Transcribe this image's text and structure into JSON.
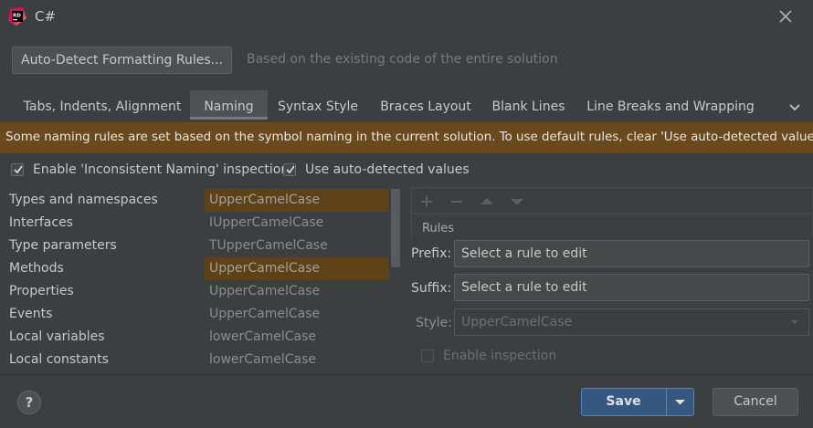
{
  "window": {
    "title": "C#",
    "logo": "rider-logo-icon",
    "close_icon": "close-icon"
  },
  "autodetect": {
    "button_label": "Auto-Detect Formatting Rules...",
    "description": "Based on the existing code of the entire solution"
  },
  "tabs": [
    {
      "label": "Tabs, Indents, Alignment",
      "active": false
    },
    {
      "label": "Naming",
      "active": true
    },
    {
      "label": "Syntax Style",
      "active": false
    },
    {
      "label": "Braces Layout",
      "active": false
    },
    {
      "label": "Blank Lines",
      "active": false
    },
    {
      "label": "Line Breaks and Wrapping",
      "active": false
    }
  ],
  "banner": {
    "text": "Some naming rules are set based on the symbol naming in the current solution. To use default rules, clear 'Use auto-detected values'.",
    "color": "#6a4a1c"
  },
  "options": {
    "inconsistent_naming": {
      "label": "Enable 'Inconsistent Naming' inspection",
      "checked": true
    },
    "auto_detected": {
      "label": "Use auto-detected values",
      "checked": true
    }
  },
  "rules": [
    {
      "name": "Types and namespaces",
      "value": "UpperCamelCase",
      "highlighted": true
    },
    {
      "name": "Interfaces",
      "value": "IUpperCamelCase",
      "highlighted": false
    },
    {
      "name": "Type parameters",
      "value": "TUpperCamelCase",
      "highlighted": false
    },
    {
      "name": "Methods",
      "value": "UpperCamelCase",
      "highlighted": true
    },
    {
      "name": "Properties",
      "value": "UpperCamelCase",
      "highlighted": false
    },
    {
      "name": "Events",
      "value": "UpperCamelCase",
      "highlighted": false
    },
    {
      "name": "Local variables",
      "value": "lowerCamelCase",
      "highlighted": false
    },
    {
      "name": "Local constants",
      "value": "lowerCamelCase",
      "highlighted": false
    }
  ],
  "editor": {
    "toolbar_icons": [
      "add-icon",
      "remove-icon",
      "move-up-icon",
      "move-down-icon"
    ],
    "rules_header": "Rules",
    "prefix_label": "Prefix:",
    "prefix_value": "Select a rule to edit",
    "suffix_label": "Suffix:",
    "suffix_value": "Select a rule to edit",
    "style_label": "Style:",
    "style_value": "UpperCamelCase",
    "enable_inspection_label": "Enable inspection",
    "enable_inspection_checked": false
  },
  "footer": {
    "help_label": "?",
    "save_label": "Save",
    "cancel_label": "Cancel",
    "accent": "#365880"
  }
}
